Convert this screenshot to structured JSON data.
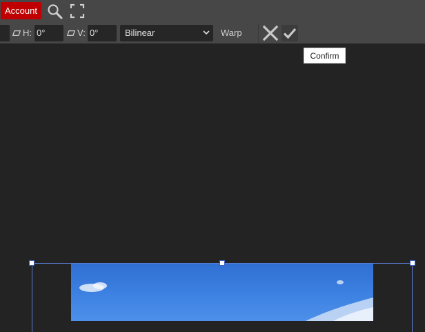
{
  "topbar": {
    "account_label": "Account",
    "icons": [
      "search-icon",
      "fullscreen-icon"
    ]
  },
  "options": {
    "skew_h_label": "H:",
    "skew_h_value": "0°",
    "skew_v_label": "V:",
    "skew_v_value": "0°",
    "interpolation_selected": "Bilinear",
    "warp_label": "Warp"
  },
  "actions": {
    "cancel_icon": "close-icon",
    "confirm_icon": "checkmark-icon"
  },
  "tooltip": {
    "text": "Confirm"
  },
  "colors": {
    "account_bg": "#c00000",
    "toolbar_bg": "#474747",
    "canvas_bg": "#232323",
    "selection_border": "#5b7fd6"
  }
}
